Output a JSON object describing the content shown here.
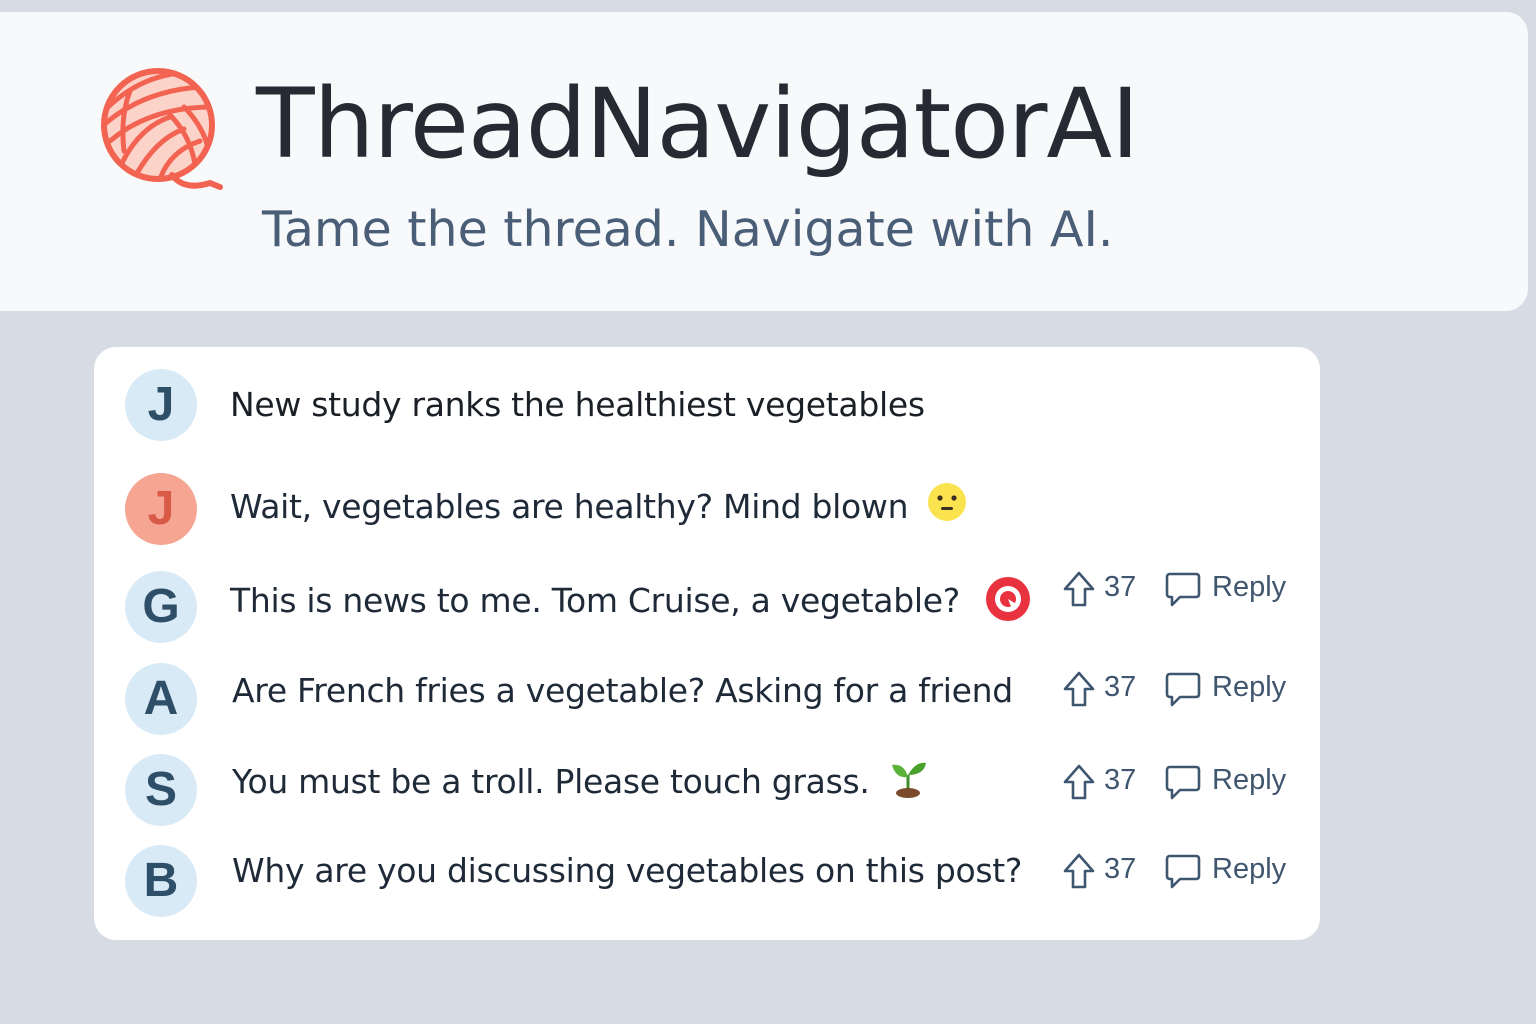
{
  "app": {
    "title": "ThreadNavigatorAI",
    "tagline": "Tame the thread. Navigate with AI.",
    "logo_icon": "yarn-ball-icon",
    "accent_color": "#f26451"
  },
  "thread": {
    "posts": [
      {
        "avatar_letter": "J",
        "text": "New study ranks the healthiest vegetables",
        "is_original_post": true
      },
      {
        "avatar_letter": "J",
        "text": "Wait, vegetables are healthy? Mind blown",
        "emoji_icon": "face-emoji-icon"
      },
      {
        "avatar_letter": "G",
        "text": "This is news to me. Tom Cruise, a vegetable?",
        "emoji_icon": "red-circle-emoji-icon",
        "upvotes": "37",
        "reply_label": "Reply"
      },
      {
        "avatar_letter": "A",
        "text": "Are French fries a vegetable? Asking for a friend",
        "upvotes": "37",
        "reply_label": "Reply"
      },
      {
        "avatar_letter": "S",
        "text": "You must be a troll. Please touch grass.",
        "emoji_icon": "seedling-emoji-icon",
        "upvotes": "37",
        "reply_label": "Reply"
      },
      {
        "avatar_letter": "B",
        "text": "Why are you discussing vegetables on this post?",
        "upvotes": "37",
        "reply_label": "Reply"
      }
    ]
  }
}
